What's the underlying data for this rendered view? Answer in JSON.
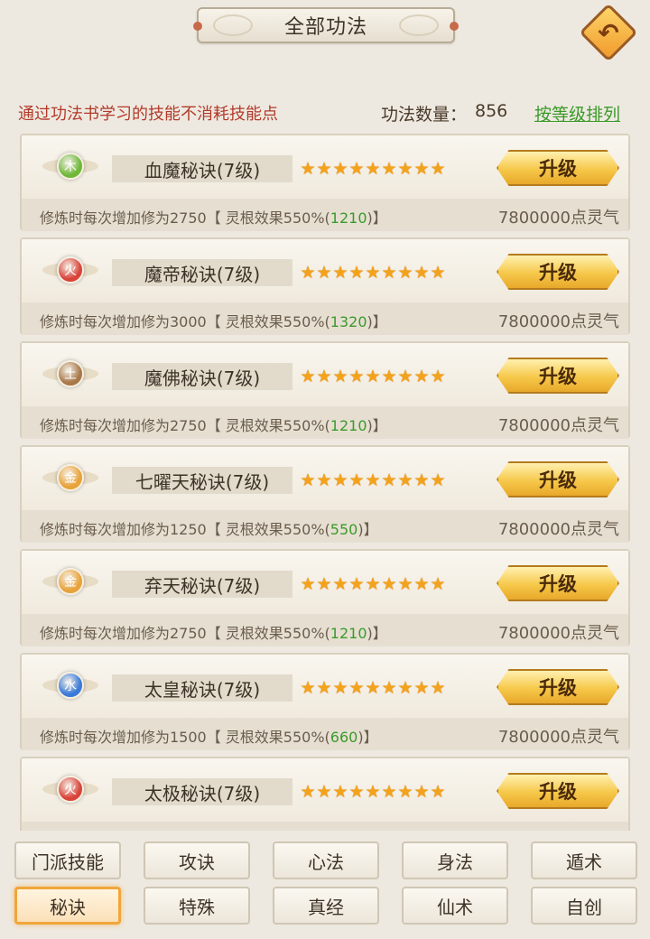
{
  "header": {
    "title": "全部功法",
    "back_icon": "back-arrow-icon"
  },
  "info": {
    "note": "通过功法书学习的技能不消耗技能点",
    "count_label": "功法数量：",
    "count_value": "856",
    "sort_link": "按等级排列"
  },
  "skills": [
    {
      "element": "木",
      "element_color": "#6fb83a",
      "name": "血魔秘诀(7级)",
      "stars": 9,
      "upgrade_label": "升级",
      "desc_prefix": "修炼时每次增加修为2750【 灵根效果550%(",
      "desc_value": "1210",
      "desc_suffix": ")】",
      "cost": "7800000点灵气"
    },
    {
      "element": "火",
      "element_color": "#d8443a",
      "name": "魔帝秘诀(7级)",
      "stars": 9,
      "upgrade_label": "升级",
      "desc_prefix": "修炼时每次增加修为3000【 灵根效果550%(",
      "desc_value": "1320",
      "desc_suffix": ")】",
      "cost": "7800000点灵气"
    },
    {
      "element": "土",
      "element_color": "#a8784a",
      "name": "魔佛秘诀(7级)",
      "stars": 9,
      "upgrade_label": "升级",
      "desc_prefix": "修炼时每次增加修为2750【 灵根效果550%(",
      "desc_value": "1210",
      "desc_suffix": ")】",
      "cost": "7800000点灵气"
    },
    {
      "element": "金",
      "element_color": "#e8a23a",
      "name": "七曜天秘诀(7级)",
      "stars": 9,
      "upgrade_label": "升级",
      "desc_prefix": "修炼时每次增加修为1250【 灵根效果550%(",
      "desc_value": "550",
      "desc_suffix": ")】",
      "cost": "7800000点灵气"
    },
    {
      "element": "金",
      "element_color": "#e8a23a",
      "name": "弃天秘诀(7级)",
      "stars": 9,
      "upgrade_label": "升级",
      "desc_prefix": "修炼时每次增加修为2750【 灵根效果550%(",
      "desc_value": "1210",
      "desc_suffix": ")】",
      "cost": "7800000点灵气"
    },
    {
      "element": "水",
      "element_color": "#3a7ad8",
      "name": "太皇秘诀(7级)",
      "stars": 9,
      "upgrade_label": "升级",
      "desc_prefix": "修炼时每次增加修为1500【 灵根效果550%(",
      "desc_value": "660",
      "desc_suffix": ")】",
      "cost": "7800000点灵气"
    },
    {
      "element": "火",
      "element_color": "#d8443a",
      "name": "太极秘诀(7级)",
      "stars": 9,
      "upgrade_label": "升级",
      "desc_prefix": "",
      "desc_value": "",
      "desc_suffix": "",
      "cost": ""
    }
  ],
  "tabs": [
    {
      "label": "门派技能",
      "active": false
    },
    {
      "label": "攻诀",
      "active": false
    },
    {
      "label": "心法",
      "active": false
    },
    {
      "label": "身法",
      "active": false
    },
    {
      "label": "遁术",
      "active": false
    },
    {
      "label": "秘诀",
      "active": true
    },
    {
      "label": "特殊",
      "active": false
    },
    {
      "label": "真经",
      "active": false
    },
    {
      "label": "仙术",
      "active": false
    },
    {
      "label": "自创",
      "active": false
    }
  ]
}
